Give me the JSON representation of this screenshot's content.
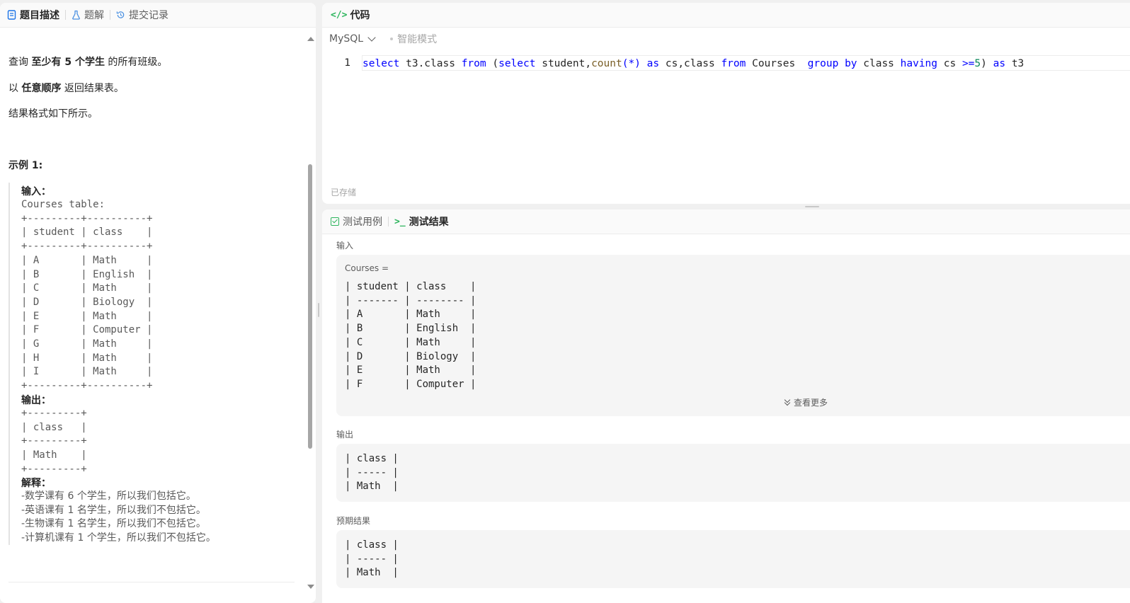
{
  "left_tabs": [
    {
      "label": "题目描述",
      "icon": "document-icon"
    },
    {
      "label": "题解",
      "icon": "flask-icon"
    },
    {
      "label": "提交记录",
      "icon": "history-icon"
    }
  ],
  "description": {
    "line1_pre": "查询 ",
    "line1_bold": "至少有 5 个学生",
    "line1_post": " 的所有班级。",
    "line2_pre": "以 ",
    "line2_bold": "任意顺序",
    "line2_post": " 返回结果表。",
    "line3": "结果格式如下所示。",
    "example_title": "示例 1:"
  },
  "example": {
    "input_label": "输入：",
    "input_table": "Courses table:\n+---------+----------+\n| student | class    |\n+---------+----------+\n| A       | Math     |\n| B       | English  |\n| C       | Math     |\n| D       | Biology  |\n| E       | Math     |\n| F       | Computer |\n| G       | Math     |\n| H       | Math     |\n| I       | Math     |\n+---------+----------+",
    "output_label": "输出：",
    "output_table": "+---------+\n| class   |\n+---------+\n| Math    |\n+---------+",
    "explain_label": "解释：",
    "explain_lines": "-数学课有 6 个学生，所以我们包括它。\n-英语课有 1 名学生，所以我们不包括它。\n-生物课有 1 名学生，所以我们不包括它。\n-计算机课有 1 个学生，所以我们不包括它。"
  },
  "code_panel": {
    "title": "代码",
    "language": "MySQL",
    "mode": "智能模式",
    "line_number": "1",
    "tokens": [
      {
        "t": "select",
        "c": "kw"
      },
      {
        "t": " t3.class ",
        "c": ""
      },
      {
        "t": "from",
        "c": "kw"
      },
      {
        "t": " (",
        "c": ""
      },
      {
        "t": "select",
        "c": "kw"
      },
      {
        "t": " student,",
        "c": ""
      },
      {
        "t": "count",
        "c": "fn"
      },
      {
        "t": "(*)",
        "c": "op"
      },
      {
        "t": " ",
        "c": ""
      },
      {
        "t": "as",
        "c": "kw"
      },
      {
        "t": " cs,class ",
        "c": ""
      },
      {
        "t": "from",
        "c": "kw"
      },
      {
        "t": " Courses  ",
        "c": ""
      },
      {
        "t": "group",
        "c": "kw"
      },
      {
        "t": " ",
        "c": ""
      },
      {
        "t": "by",
        "c": "kw"
      },
      {
        "t": " class ",
        "c": ""
      },
      {
        "t": "having",
        "c": "kw"
      },
      {
        "t": " cs ",
        "c": ""
      },
      {
        "t": ">=",
        "c": "op"
      },
      {
        "t": "5",
        "c": "num"
      },
      {
        "t": ") ",
        "c": ""
      },
      {
        "t": "as",
        "c": "kw"
      },
      {
        "t": " t3",
        "c": ""
      }
    ],
    "saved_status": "已存储"
  },
  "result_panel": {
    "tabs": [
      {
        "label": "测试用例"
      },
      {
        "label": "测试结果"
      }
    ],
    "input_label": "输入",
    "input_var": "Courses =",
    "input_table": "| student | class    |\n| ------- | -------- |\n| A       | Math     |\n| B       | English  |\n| C       | Math     |\n| D       | Biology  |\n| E       | Math     |\n| F       | Computer |",
    "show_more": "查看更多",
    "output_label": "输出",
    "output_table": "| class |\n| ----- |\n| Math  |",
    "expected_label": "预期结果",
    "expected_table": "| class |\n| ----- |\n| Math  |"
  },
  "colors": {
    "accent_green": "#2db55d",
    "keyword_blue": "#0000ff",
    "function_brown": "#795e26",
    "number_green": "#098658"
  }
}
